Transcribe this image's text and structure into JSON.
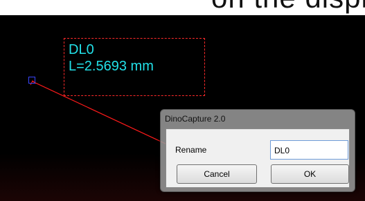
{
  "top_fragment": {
    "text": "on the display using) cr..."
  },
  "measurement": {
    "name": "DL0",
    "length_text": "L=2.5693 mm",
    "label_color": "#22e0e8",
    "line_color": "#ff1a1a",
    "box_border_color": "#ff2a2a",
    "marker_color": "#3a46ff"
  },
  "dialog": {
    "title": "DinoCapture 2.0",
    "rename_label": "Rename",
    "rename_value": "DL0",
    "cancel_label": "Cancel",
    "ok_label": "OK"
  }
}
